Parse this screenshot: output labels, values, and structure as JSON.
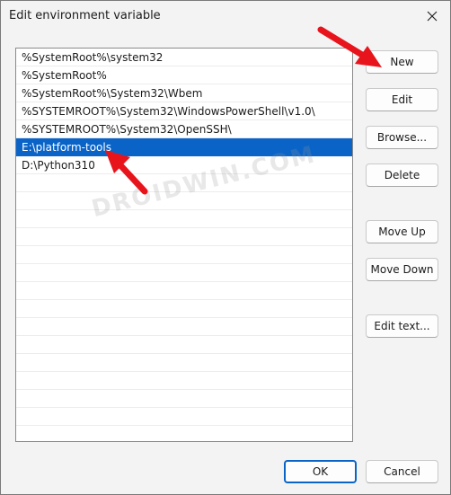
{
  "window": {
    "title": "Edit environment variable",
    "close_icon": "close-icon"
  },
  "list": {
    "items": [
      "%SystemRoot%\\system32",
      "%SystemRoot%",
      "%SystemRoot%\\System32\\Wbem",
      "%SYSTEMROOT%\\System32\\WindowsPowerShell\\v1.0\\",
      "%SYSTEMROOT%\\System32\\OpenSSH\\",
      "E:\\platform-tools",
      "D:\\Python310"
    ],
    "selected_index": 5
  },
  "buttons": {
    "new": "New",
    "edit": "Edit",
    "browse": "Browse...",
    "delete": "Delete",
    "move_up": "Move Up",
    "move_down": "Move Down",
    "edit_text": "Edit text...",
    "ok": "OK",
    "cancel": "Cancel"
  },
  "watermark": {
    "text": "DROIDWIN.COM"
  },
  "colors": {
    "selection": "#0a64c8",
    "annotation_arrow": "#e8141c",
    "dialog_background": "#f3f3f3"
  }
}
